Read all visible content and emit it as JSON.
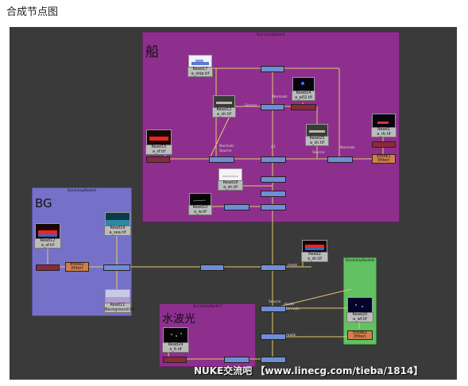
{
  "page": {
    "title": "合成节点图"
  },
  "backdrops": {
    "ship": {
      "header": "BackdropNode6",
      "label": "船",
      "color": "#8e2f8e"
    },
    "bg": {
      "header": "BackdropNode4",
      "label": "BG",
      "color": "#7570c8"
    },
    "water": {
      "header": "BackdropNode7",
      "label": "水波光",
      "color": "#8e2f8e"
    },
    "green": {
      "header": "BackdropNode8",
      "color": "#62c163"
    }
  },
  "reads": [
    {
      "id": "read17",
      "label": "Read17",
      "sub": "a_ship.tif"
    },
    {
      "id": "read14",
      "label": "Read14",
      "sub": "a_p02.tif"
    },
    {
      "id": "read12a",
      "label": "Read12",
      "sub": "a_sh.tif"
    },
    {
      "id": "read25",
      "label": "Read25",
      "sub": "a_sh.tif"
    },
    {
      "id": "read1",
      "label": "Read1",
      "sub": "a_rb.tif"
    },
    {
      "id": "read15",
      "label": "Read15",
      "sub": "a_sf.tif"
    },
    {
      "id": "read18",
      "label": "Read18",
      "sub": "a_sh.tif"
    },
    {
      "id": "read10",
      "label": "Read10",
      "sub": "a_w.tif"
    },
    {
      "id": "read12b",
      "label": "Read12",
      "sub": "a_sf.tif"
    },
    {
      "id": "read19",
      "label": "Read19",
      "sub": "a_sea.tif"
    },
    {
      "id": "read11",
      "label": "Read11",
      "sub": "Background.tif"
    },
    {
      "id": "read2",
      "label": "Read2",
      "sub": "a_sh.tif"
    },
    {
      "id": "read20",
      "label": "Read20",
      "sub": "a_wf.tif"
    },
    {
      "id": "read24",
      "label": "Read24",
      "sub": "a_lt.tif"
    }
  ],
  "erodes": [
    {
      "id": "erode1",
      "label": "Erode1",
      "sub": "(filter)"
    },
    {
      "id": "erode2",
      "label": "Erode2",
      "sub": "(filter)"
    },
    {
      "id": "erode3",
      "label": "Erode2",
      "sub": "(filter)"
    }
  ],
  "wire_labels": {
    "normals1": "Normals",
    "normals2": "Normals",
    "source1": "Source",
    "normals3": "Normals",
    "source2": "Source",
    "a1": "A1",
    "source3": "Source",
    "b": "B",
    "normals4": "Normals",
    "source4": "Source",
    "mask1": "mask",
    "source5": "Source",
    "normals5": "Normals",
    "mask2": "mask",
    "mask3": "mask"
  },
  "watermark": "NUKE交流吧 【www.linecg.com/tieba/1814】"
}
